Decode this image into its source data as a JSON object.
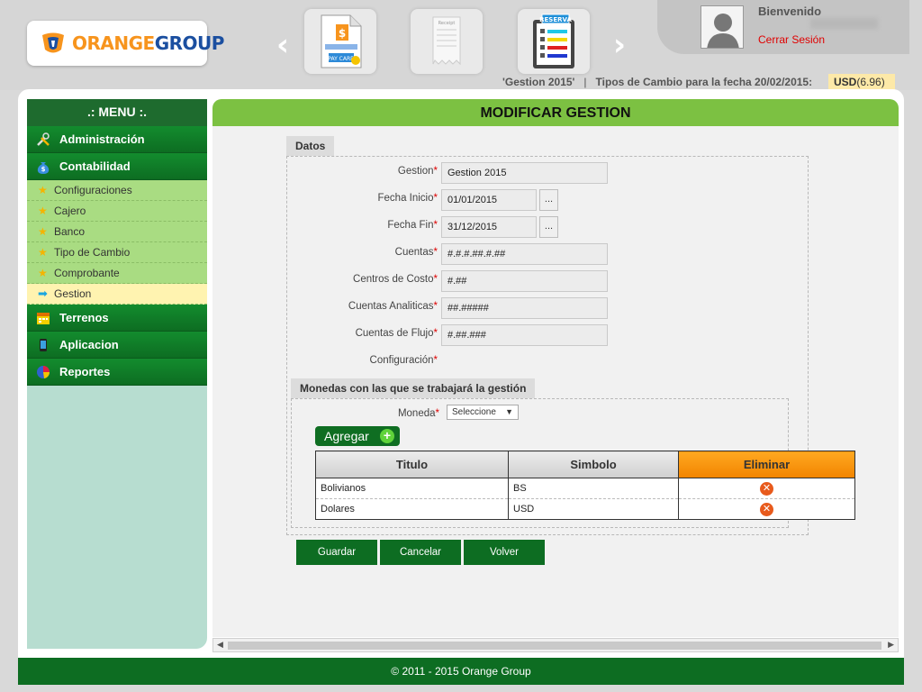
{
  "header": {
    "logo": {
      "part1": "ORANGE",
      "part2": "GROUP"
    },
    "welcome": "Bienvenido",
    "logout": "Cerrar Sesión",
    "info": {
      "gestion": "'Gestion 2015'",
      "separator": "|",
      "exchange_label": "Tipos de Cambio para la fecha 20/02/2015:"
    },
    "usd": {
      "code": "USD",
      "rate": "(6.96)"
    },
    "quick_tiles": [
      {
        "icon": "pay-card-icon",
        "label": "PAY CARD"
      },
      {
        "icon": "receipt-icon",
        "label": "Receipt"
      },
      {
        "icon": "reserva-checklist-icon",
        "label": "RESERVA"
      }
    ]
  },
  "sidebar": {
    "title": ".: MENU :.",
    "groups": [
      {
        "label": "Administración",
        "icon": "tools-icon"
      },
      {
        "label": "Contabilidad",
        "icon": "money-bag-icon"
      }
    ],
    "sub_items": [
      {
        "label": "Configuraciones"
      },
      {
        "label": "Cajero"
      },
      {
        "label": "Banco"
      },
      {
        "label": "Tipo de Cambio"
      },
      {
        "label": "Comprobante"
      },
      {
        "label": "Gestion",
        "active": true
      }
    ],
    "groups_after": [
      {
        "label": "Terrenos",
        "icon": "calendar-icon"
      },
      {
        "label": "Aplicacion",
        "icon": "phone-icon"
      },
      {
        "label": "Reportes",
        "icon": "pie-chart-icon"
      }
    ]
  },
  "page": {
    "title": "MODIFICAR GESTION",
    "datos_tab": "Datos",
    "fields": {
      "gestion": {
        "label": "Gestion",
        "value": "Gestion 2015"
      },
      "fecha_inicio": {
        "label": "Fecha Inicio",
        "value": "01/01/2015"
      },
      "fecha_fin": {
        "label": "Fecha Fin",
        "value": "31/12/2015"
      },
      "cuentas": {
        "label": "Cuentas",
        "value": "#.#.#.##.#.##"
      },
      "centros_costo": {
        "label": "Centros de Costo",
        "value": "#.##"
      },
      "cuentas_analiticas": {
        "label": "Cuentas Analiticas",
        "value": "##.#####"
      },
      "cuentas_flujo": {
        "label": "Cuentas de Flujo",
        "value": "#.##.###"
      },
      "configuracion": {
        "label": "Configuración"
      }
    },
    "required_mark": "*",
    "date_button": "...",
    "monedas": {
      "title": "Monedas con las que se trabajará la gestión",
      "moneda_label": "Moneda",
      "select_value": "Seleccione",
      "agregar": "Agregar",
      "columns": [
        "Titulo",
        "Simbolo",
        "Eliminar"
      ],
      "rows": [
        {
          "titulo": "Bolivianos",
          "simbolo": "BS"
        },
        {
          "titulo": "Dolares",
          "simbolo": "USD"
        }
      ]
    },
    "buttons": {
      "guardar": "Guardar",
      "cancelar": "Cancelar",
      "volver": "Volver"
    }
  },
  "footer": "© 2011 - 2015 Orange Group",
  "colors": {
    "primary_green": "#0d6d22",
    "header_green": "#7cc142",
    "accent_orange": "#f28400",
    "danger": "#e00000"
  }
}
